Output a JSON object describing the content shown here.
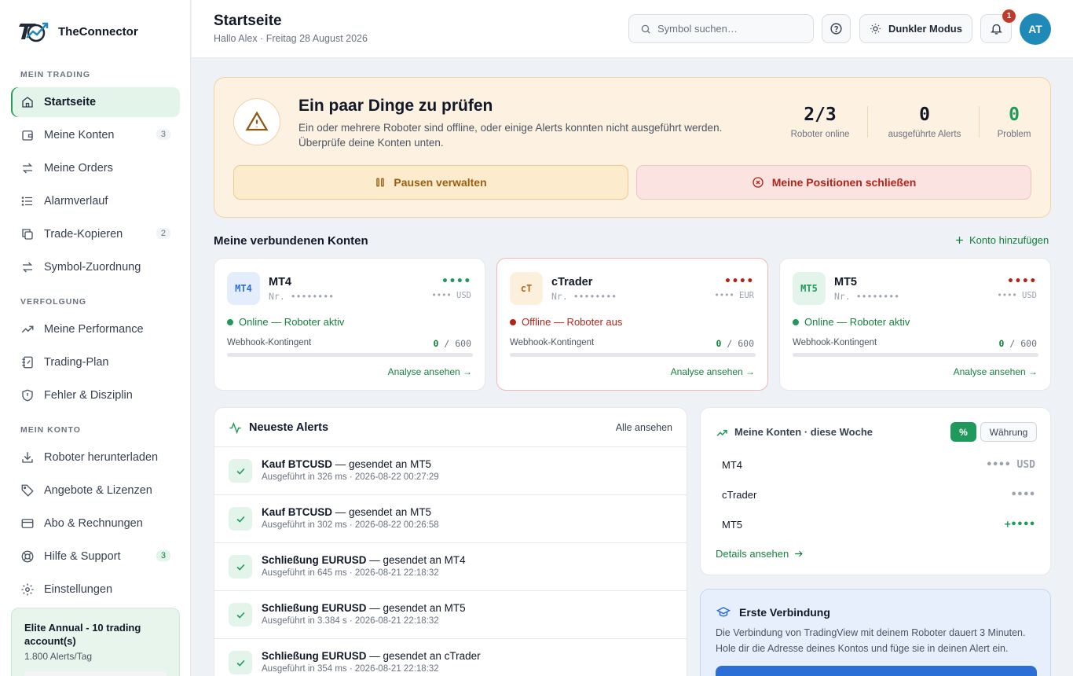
{
  "brand": {
    "name": "TheConnector"
  },
  "sidebar": {
    "sections": [
      "MEIN TRADING",
      "VERFOLGUNG",
      "MEIN KONTO"
    ],
    "items": [
      {
        "label": "Startseite",
        "icon": "home-icon"
      },
      {
        "label": "Meine Konten",
        "icon": "wallet-icon",
        "badge": "3"
      },
      {
        "label": "Meine Orders",
        "icon": "swap-icon"
      },
      {
        "label": "Alarmverlauf",
        "icon": "list-icon"
      },
      {
        "label": "Trade-Kopieren",
        "icon": "copy-icon",
        "badge": "2"
      },
      {
        "label": "Symbol-Zuordnung",
        "icon": "swap-icon"
      },
      {
        "label": "Meine Performance",
        "icon": "trend-icon"
      },
      {
        "label": "Trading-Plan",
        "icon": "notebook-icon"
      },
      {
        "label": "Fehler & Disziplin",
        "icon": "shield-icon"
      },
      {
        "label": "Roboter herunterladen",
        "icon": "download-icon"
      },
      {
        "label": "Angebote & Lizenzen",
        "icon": "tag-icon"
      },
      {
        "label": "Abo & Rechnungen",
        "icon": "card-icon"
      },
      {
        "label": "Hilfe & Support",
        "icon": "lifebuoy-icon",
        "badge": "3"
      },
      {
        "label": "Einstellungen",
        "icon": "gear-icon"
      }
    ],
    "plan": {
      "title": "Elite Annual - 10 trading account(s)",
      "sub": "1.800 Alerts/Tag"
    }
  },
  "header": {
    "title": "Startseite",
    "subtitle": "Hallo Alex · Freitag 28 August 2026",
    "search_placeholder": "Symbol suchen…",
    "dark_mode_label": "Dunkler Modus",
    "notif_count": "1",
    "avatar_initials": "AT"
  },
  "warning": {
    "title": "Ein paar Dinge zu prüfen",
    "text": "Ein oder mehrere Roboter sind offline, oder einige Alerts konnten nicht ausgeführt werden. Überprüfe deine Konten unten.",
    "stats": [
      {
        "value": "2/3",
        "label": "Roboter online"
      },
      {
        "value": "0",
        "label": "ausgeführte Alerts"
      },
      {
        "value": "0",
        "label": "Problem"
      }
    ],
    "pause_label": "Pausen verwalten",
    "close_label": "Meine Positionen schließen"
  },
  "accounts": {
    "title": "Meine verbundenen Konten",
    "add_label": "Konto hinzufügen",
    "items": [
      {
        "logo": "MT4",
        "name": "MT4",
        "nr": "Nr. ••••••••",
        "dots": "••••",
        "currency": "•••• USD",
        "status": "Online — Roboter aktiv",
        "webhook_label": "Webhook-Kontingent",
        "used": "0",
        "total": "/ 600",
        "link": "Analyse ansehen →"
      },
      {
        "logo": "cT",
        "name": "cTrader",
        "nr": "Nr. ••••••••",
        "dots": "••••",
        "currency": "•••• EUR",
        "status": "Offline — Roboter aus",
        "webhook_label": "Webhook-Kontingent",
        "used": "0",
        "total": "/ 600",
        "link": "Analyse ansehen →"
      },
      {
        "logo": "MT5",
        "name": "MT5",
        "nr": "Nr. ••••••••",
        "dots": "••••",
        "currency": "•••• USD",
        "status": "Online — Roboter aktiv",
        "webhook_label": "Webhook-Kontingent",
        "used": "0",
        "total": "/ 600",
        "link": "Analyse ansehen →"
      }
    ]
  },
  "alerts": {
    "title": "Neueste Alerts",
    "all_label": "Alle ansehen",
    "rows": [
      {
        "action": "Kauf BTCUSD",
        "target": " — gesendet an MT5",
        "sub": "Ausgeführt in 326 ms · 2026-08-22 00:27:29"
      },
      {
        "action": "Kauf BTCUSD",
        "target": " — gesendet an MT5",
        "sub": "Ausgeführt in 302 ms · 2026-08-22 00:26:58"
      },
      {
        "action": "Schließung EURUSD",
        "target": " — gesendet an MT4",
        "sub": "Ausgeführt in 645 ms · 2026-08-21 22:18:32"
      },
      {
        "action": "Schließung EURUSD",
        "target": " — gesendet an MT5",
        "sub": "Ausgeführt in 3.384 s · 2026-08-21 22:18:32"
      },
      {
        "action": "Schließung EURUSD",
        "target": " — gesendet an cTrader",
        "sub": "Ausgeführt in 354 ms · 2026-08-21 22:18:32"
      }
    ]
  },
  "weekly": {
    "title": "Meine Konten · diese Woche",
    "pct_label": "%",
    "cur_label": "Währung",
    "rows": [
      {
        "name": "MT4",
        "value": "•••• USD"
      },
      {
        "name": "cTrader",
        "value": "••••"
      },
      {
        "name": "MT5",
        "value": "+••••"
      }
    ],
    "details_label": "Details ansehen"
  },
  "first_connection": {
    "title": "Erste Verbindung",
    "text": "Die Verbindung von TradingView mit deinem Roboter dauert 3 Minuten. Hole dir die Adresse deines Kontos und füge sie in deinen Alert ein."
  },
  "colors": {
    "accent": "#15803d",
    "danger": "#b42318",
    "warning": "#9a5f12",
    "brand_blue": "#1f8ab8"
  }
}
